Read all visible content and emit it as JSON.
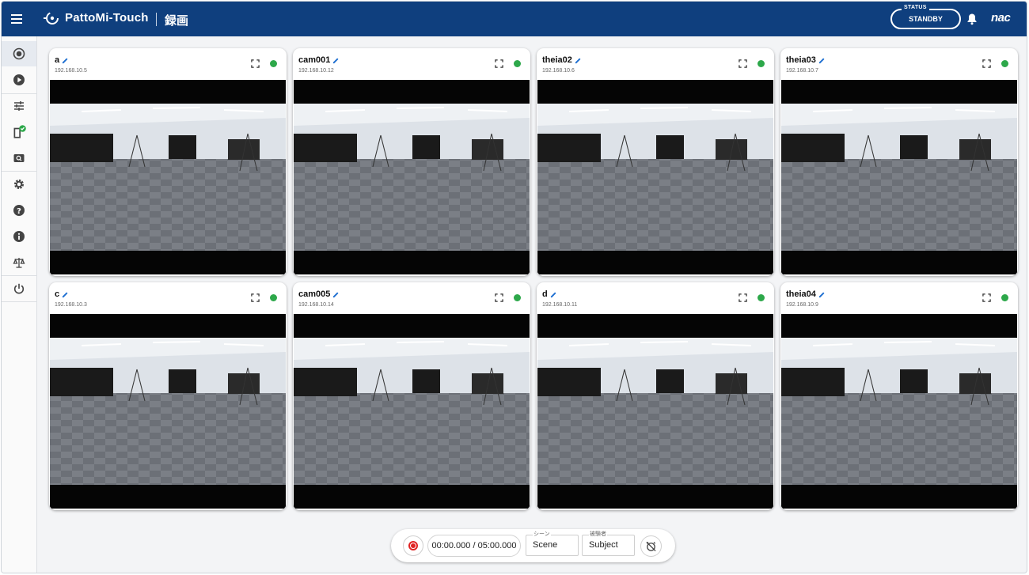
{
  "header": {
    "app_name": "PattoMi-Touch",
    "page_title": "録画",
    "status_caption": "STATUS",
    "status_value": "STANDBY",
    "brand": "nac",
    "background": "#0f3f7e"
  },
  "sidebar": {
    "items": [
      {
        "name": "record-icon",
        "active": true
      },
      {
        "name": "play-icon"
      },
      {
        "name": "sliders-icon"
      },
      {
        "name": "device-check-icon"
      },
      {
        "name": "camera-search-icon"
      },
      {
        "name": "gear-icon"
      },
      {
        "name": "help-icon"
      },
      {
        "name": "info-icon"
      },
      {
        "name": "scale-icon"
      },
      {
        "name": "power-icon"
      }
    ]
  },
  "cameras": [
    {
      "name": "a",
      "ip": "192.168.10.5",
      "status_color": "#2da84a"
    },
    {
      "name": "cam001",
      "ip": "192.168.10.12",
      "status_color": "#2da84a"
    },
    {
      "name": "theia02",
      "ip": "192.168.10.6",
      "status_color": "#2da84a"
    },
    {
      "name": "theia03",
      "ip": "192.168.10.7",
      "status_color": "#2da84a"
    },
    {
      "name": "c",
      "ip": "192.168.10.3",
      "status_color": "#2da84a"
    },
    {
      "name": "cam005",
      "ip": "192.168.10.14",
      "status_color": "#2da84a"
    },
    {
      "name": "d",
      "ip": "192.168.10.11",
      "status_color": "#2da84a"
    },
    {
      "name": "theia04",
      "ip": "192.168.10.9",
      "status_color": "#2da84a"
    }
  ],
  "controls": {
    "time": "00:00.000 / 05:00.000",
    "scene_label": "シーン",
    "scene_value": "Scene",
    "subject_label": "被験者",
    "subject_value": "Subject",
    "record_color": "#e02424"
  }
}
